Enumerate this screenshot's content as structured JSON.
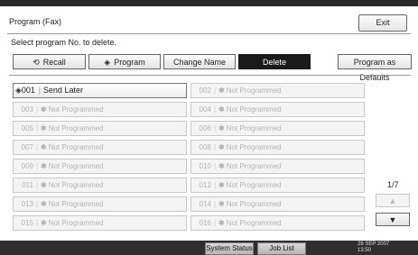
{
  "header": {
    "title": "Program (Fax)",
    "exit_label": "Exit"
  },
  "instruction": "Select program No. to delete.",
  "tabs": [
    {
      "label": "Recall",
      "icon": "recall-icon",
      "glyph": "⟲"
    },
    {
      "label": "Program",
      "icon": "program-icon",
      "glyph": "◈"
    },
    {
      "label": "Change Name"
    },
    {
      "label": "Delete",
      "active": true
    }
  ],
  "program_as_defaults_label": "Program as Defaults",
  "programs": [
    {
      "num": "001",
      "name": "Send Later",
      "set": true
    },
    {
      "num": "002",
      "name": "Not Programmed",
      "set": false
    },
    {
      "num": "003",
      "name": "Not Programmed",
      "set": false
    },
    {
      "num": "004",
      "name": "Not Programmed",
      "set": false
    },
    {
      "num": "005",
      "name": "Not Programmed",
      "set": false
    },
    {
      "num": "006",
      "name": "Not Programmed",
      "set": false
    },
    {
      "num": "007",
      "name": "Not Programmed",
      "set": false
    },
    {
      "num": "008",
      "name": "Not Programmed",
      "set": false
    },
    {
      "num": "009",
      "name": "Not Programmed",
      "set": false
    },
    {
      "num": "010",
      "name": "Not Programmed",
      "set": false
    },
    {
      "num": "011",
      "name": "Not Programmed",
      "set": false
    },
    {
      "num": "012",
      "name": "Not Programmed",
      "set": false
    },
    {
      "num": "013",
      "name": "Not Programmed",
      "set": false
    },
    {
      "num": "014",
      "name": "Not Programmed",
      "set": false
    },
    {
      "num": "015",
      "name": "Not Programmed",
      "set": false
    },
    {
      "num": "016",
      "name": "Not Programmed",
      "set": false
    }
  ],
  "pagination": {
    "page": "1/7",
    "up_glyph": "▲",
    "down_glyph": "▼"
  },
  "statusbar": {
    "system_status_label": "System Status",
    "job_list_label": "Job List",
    "date_line1": "28 SEP  2007",
    "date_line2": "13:50"
  }
}
